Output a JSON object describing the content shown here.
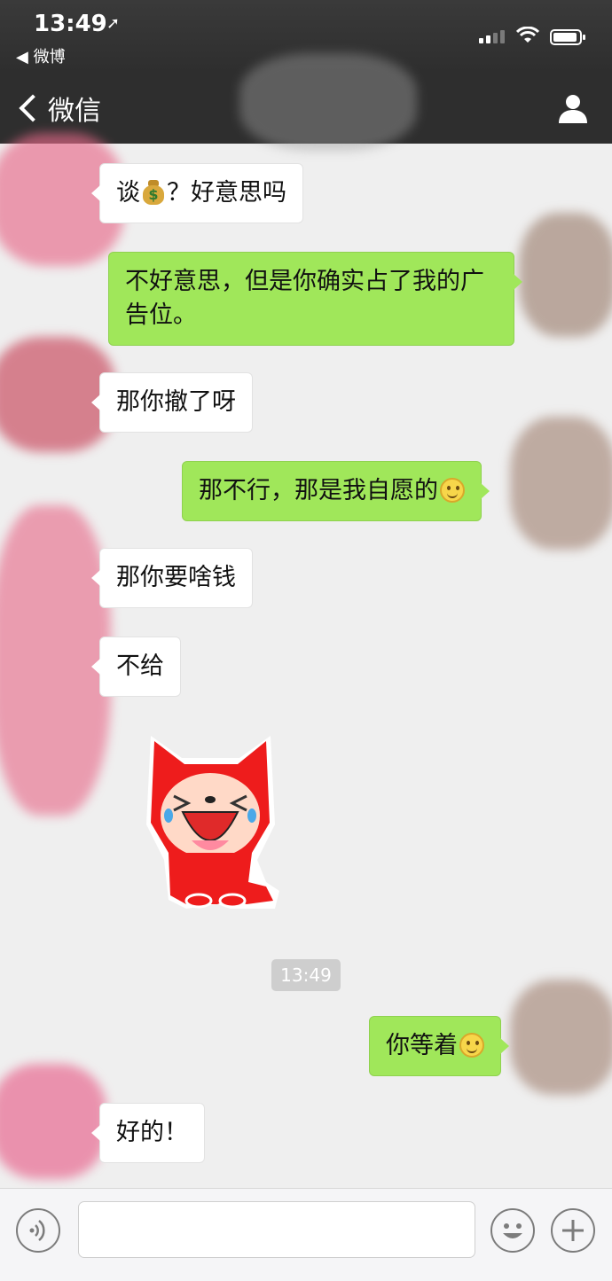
{
  "status_bar": {
    "time": "13:49",
    "back_app": "◀ 微博"
  },
  "nav": {
    "back_label": "微信"
  },
  "messages": [
    {
      "side": "left",
      "text_before": "谈",
      "emoji": "money-bag",
      "text_after": "？好意思吗"
    },
    {
      "side": "right",
      "text": "不好意思，但是你确实占了我的广告位。"
    },
    {
      "side": "left",
      "text": "那你撤了呀"
    },
    {
      "side": "right",
      "text": "那不行，那是我自愿的",
      "emoji": "smile"
    },
    {
      "side": "left",
      "text": "那你要啥钱"
    },
    {
      "side": "left",
      "text": "不给"
    },
    {
      "side": "left",
      "type": "sticker",
      "sticker": "crying-red-fox"
    },
    {
      "side": "right",
      "text": "你等着",
      "emoji": "smile"
    },
    {
      "side": "left",
      "text": "好的！"
    }
  ],
  "timestamp": "13:49",
  "colors": {
    "header_bg": "#2e2e2e",
    "chat_bg": "#efefef",
    "outgoing_bubble": "#a0e75a",
    "incoming_bubble": "#ffffff"
  },
  "input_bar": {
    "icons": [
      "voice-icon",
      "emoji-icon",
      "plus-icon"
    ]
  }
}
